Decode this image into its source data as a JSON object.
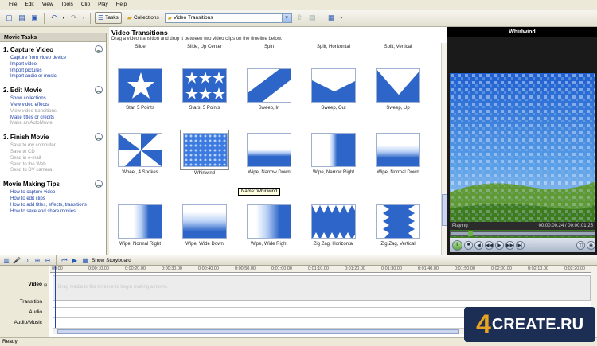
{
  "menu": [
    "File",
    "Edit",
    "View",
    "Tools",
    "Clip",
    "Play",
    "Help"
  ],
  "toolbar": {
    "tasks_label": "Tasks",
    "collections_label": "Collections",
    "combo_value": "Video Transitions"
  },
  "tasks": {
    "header": "Movie Tasks",
    "sections": [
      {
        "title": "1. Capture Video",
        "links": [
          "Capture from video device",
          "Import video",
          "Import pictures",
          "Import audio or music"
        ]
      },
      {
        "title": "2. Edit Movie",
        "links": [
          "Show collections",
          "View video effects",
          "View video transitions",
          "Make titles or credits",
          "Make an AutoMovie"
        ]
      },
      {
        "title": "3. Finish Movie",
        "links": [
          "Save to my computer",
          "Save to CD",
          "Send in e-mail",
          "Send to the Web",
          "Send to DV camera"
        ]
      },
      {
        "title": "Movie Making Tips",
        "links": [
          "How to capture video",
          "How to edit clips",
          "How to add titles, effects, transitions",
          "How to save and share movies"
        ]
      }
    ]
  },
  "content": {
    "title": "Video Transitions",
    "subtitle": "Drag a video transition and drop it between two video clips on the timeline below."
  },
  "top_labels": [
    "Slide",
    "Slide, Up Center",
    "Spin",
    "Split, Horizontal",
    "Split, Vertical"
  ],
  "transitions": [
    "Star, 5 Points",
    "Stars, 5 Points",
    "Sweep, In",
    "Sweep, Out",
    "Sweep, Up",
    "Wheel, 4 Spokes",
    "Whirlwind",
    "Wipe, Narrow Down",
    "Wipe, Narrow Right",
    "Wipe, Normal Down",
    "Wipe, Normal Right",
    "Wipe, Wide Down",
    "Wipe, Wide Right",
    "Zig Zag, Horizontal",
    "Zig Zag, Vertical"
  ],
  "tooltip": "Name: Whirlwind",
  "monitor": {
    "title": "Whirlwind",
    "status": "Playing",
    "time": "00:00:00.24 / 00:00:01.25"
  },
  "timeline": {
    "storyboard_label": "Show Storyboard",
    "tracks": [
      "Video",
      "Transition",
      "Audio",
      "Audio/Music"
    ],
    "hint": "Drag media to the timeline to begin making a movie.",
    "ticks": [
      "00:00",
      "0:00:10.00",
      "0:00:20.00",
      "0:00:30.00",
      "0:00:40.00",
      "0:00:50.00",
      "0:01:00.00",
      "0:01:10.00",
      "0:01:20.00",
      "0:01:30.00",
      "0:01:40.00",
      "0:01:50.00",
      "0:02:00.00",
      "0:02:10.00",
      "0:02:20.00"
    ]
  },
  "status_bar": "Ready",
  "watermark": {
    "number": "4",
    "text": "CREATE.RU"
  },
  "colors": {
    "transition_blue": "#2d66c8",
    "link": "#1b3ea6",
    "bar": "#ece9d8"
  }
}
